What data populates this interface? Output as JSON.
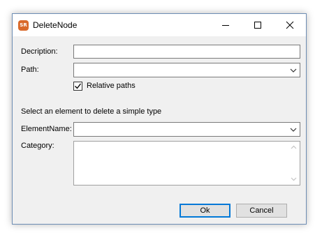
{
  "window": {
    "title": "DeleteNode",
    "icon_label": "SR",
    "icon": "app-sr-icon",
    "controls": [
      "minimize-icon",
      "maximize-icon",
      "close-icon"
    ]
  },
  "form": {
    "description_label": "Decription:",
    "description_value": "",
    "path_label": "Path:",
    "path_value": "",
    "relative_paths_label": "Relative paths",
    "relative_paths_checked": true,
    "section_text": "Select an element to delete a simple type",
    "element_name_label": "ElementName:",
    "element_name_value": "",
    "category_label": "Category:",
    "category_value": ""
  },
  "buttons": {
    "ok_label": "Ok",
    "cancel_label": "Cancel"
  },
  "colors": {
    "dialog_bg": "#f0f0f0",
    "titlebar_bg": "#ffffff",
    "icon_bg": "#d9692a",
    "default_button_border": "#0078d7"
  }
}
